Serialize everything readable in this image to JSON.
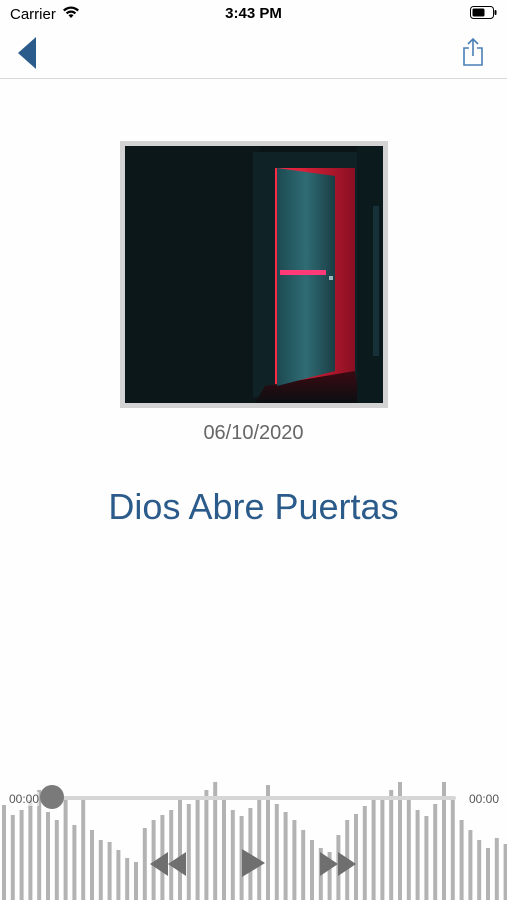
{
  "status_bar": {
    "carrier": "Carrier",
    "time": "3:43 PM",
    "wifi_icon": "wifi-icon",
    "battery_icon": "battery-icon"
  },
  "nav": {
    "back_icon": "chevron-left-icon",
    "share_icon": "share-icon",
    "accent_color": "#2b5b8a"
  },
  "episode": {
    "date": "06/10/2020",
    "title": "Dios Abre Puertas",
    "artwork": "dark-door-red-light-artwork"
  },
  "player": {
    "elapsed": "00:00",
    "total": "00:00",
    "progress": 0,
    "rewind_icon": "rewind-icon",
    "play_icon": "play-icon",
    "forward_icon": "fast-forward-icon",
    "waveform_color": "#b3b3b3",
    "controls_color": "#6f6f6f"
  }
}
